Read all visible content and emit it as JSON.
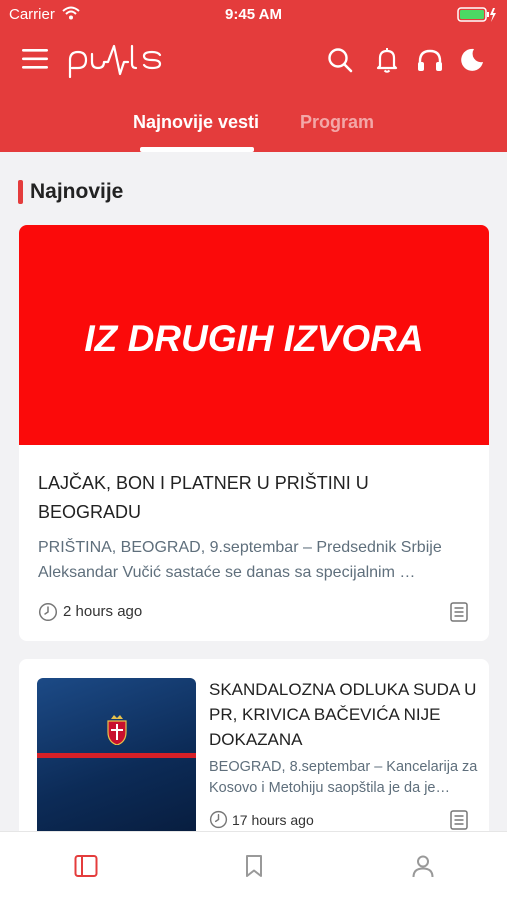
{
  "status_bar": {
    "carrier": "Carrier",
    "time": "9:45 AM"
  },
  "header": {
    "logo_text": "puls"
  },
  "tabs": [
    {
      "label": "Najnovije vesti",
      "active": true
    },
    {
      "label": "Program",
      "active": false
    }
  ],
  "section": {
    "title": "Najnovije"
  },
  "articles": [
    {
      "image_text": "IZ DRUGIH IZVORA",
      "title": "LAJČAK, BON I PLATNER U PRIŠTINI U BEOGRADU",
      "excerpt": "PRIŠTINA, BEOGRAD, 9.septembar – Predsednik Srbije Aleksandar Vučić sastaće se danas sa specijalnim …",
      "time": "2 hours ago"
    },
    {
      "title": "SKANDALOZNA ODLUKA SUDA U PR, KRIVICA BAČEVIĆA NIJE DOKAZANA",
      "excerpt": "BEOGRAD, 8.septembar – Kancelarija za Kosovo i Metohiju saopštila je da je…",
      "time": "17 hours ago"
    }
  ],
  "colors": {
    "brand_red": "#e43c3c",
    "image_red": "#fb0a0a",
    "excerpt_gray": "#5f6f7c",
    "battery_green": "#4cd964"
  },
  "icons": [
    "wifi-icon",
    "battery-icon",
    "menu-icon",
    "puls-logo",
    "search-icon",
    "bell-icon",
    "headphones-icon",
    "moon-icon",
    "clock-icon",
    "article-icon",
    "news-feed-icon",
    "bookmark-icon",
    "profile-icon"
  ]
}
